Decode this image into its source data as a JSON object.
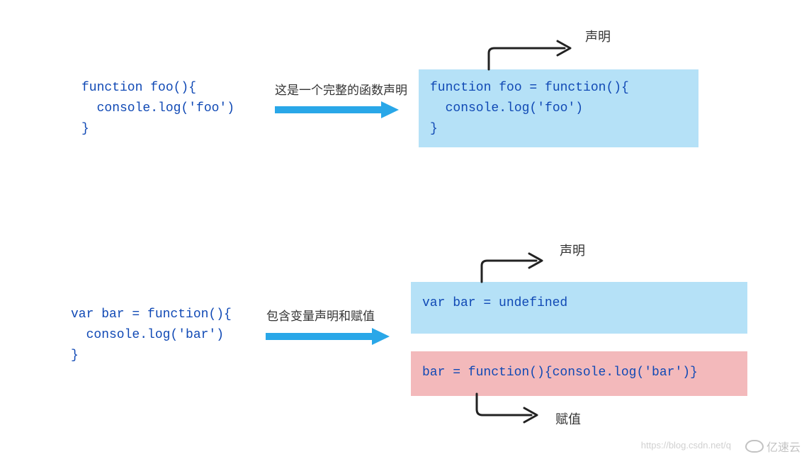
{
  "section1": {
    "left_code": "function foo(){\n  console.log('foo')\n}",
    "annotation": "这是一个完整的函数声明",
    "right_code": "function foo = function(){\n  console.log('foo')\n}",
    "top_label": "声明"
  },
  "section2": {
    "left_code": "var bar = function(){\n  console.log('bar')\n}",
    "annotation": "包含变量声明和赋值",
    "right_blue_code": "var bar = undefined",
    "right_pink_code": "bar = function(){console.log('bar')}",
    "top_label": "声明",
    "bottom_label": "赋值"
  },
  "watermark": {
    "url": "https://blog.csdn.net/q",
    "brand": "亿速云"
  }
}
